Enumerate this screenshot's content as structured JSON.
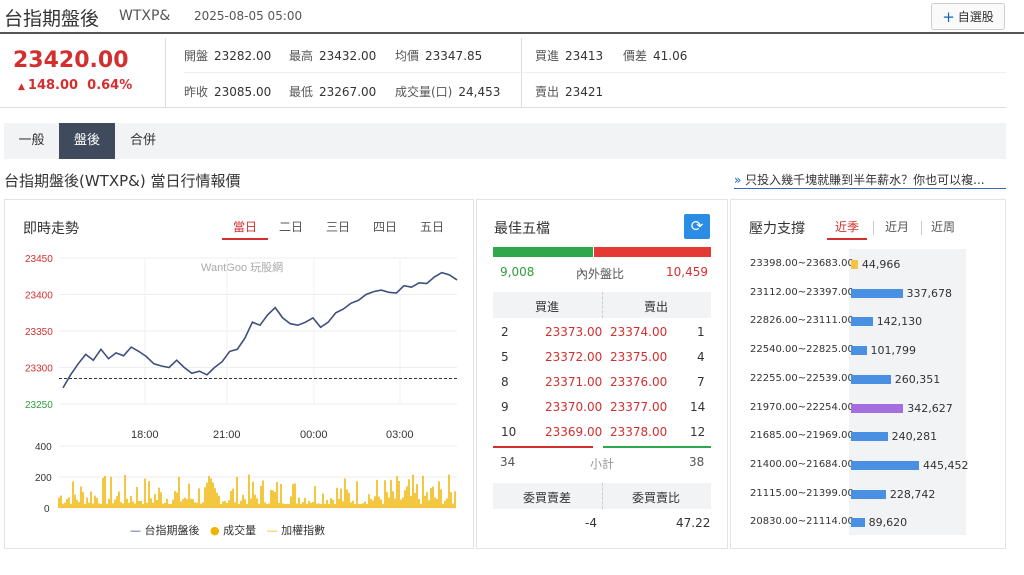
{
  "header": {
    "name": "台指期盤後",
    "code": "WTXP&",
    "time": "2025-08-05 05:00",
    "add_label": "自選股"
  },
  "quote": {
    "price": "23420.00",
    "change": "148.00",
    "pct": "0.64%",
    "open_label": "開盤",
    "open": "23282.00",
    "high_label": "最高",
    "high": "23432.00",
    "avg_label": "均價",
    "avg": "23347.85",
    "bid_label": "買進",
    "bid": "23413",
    "spread_label": "價差",
    "spread": "41.06",
    "prev_label": "昨收",
    "prev": "23085.00",
    "low_label": "最低",
    "low": "23267.00",
    "vol_label": "成交量(口)",
    "vol": "24,453",
    "ask_label": "賣出",
    "ask": "23421"
  },
  "tabs": [
    "一般",
    "盤後",
    "合併"
  ],
  "subtitle": "台指期盤後(WTXP&) 當日行情報價",
  "promo": "只投入幾千塊就賺到半年薪水？你也可以複...",
  "trend": {
    "title": "即時走勢",
    "ranges": [
      "當日",
      "二日",
      "三日",
      "四日",
      "五日"
    ],
    "watermark": "WantGoo 玩股網",
    "legend": [
      "台指期盤後",
      "成交量",
      "加權指數"
    ]
  },
  "chart_data": {
    "type": "line",
    "x_ticks": [
      "18:00",
      "21:00",
      "00:00",
      "03:00"
    ],
    "ylim": [
      23250,
      23450
    ],
    "y_ticks": [
      23450,
      23400,
      23350,
      23300,
      23250
    ],
    "reference": 23285,
    "series": [
      {
        "name": "台指期盤後",
        "values": [
          23272,
          23290,
          23305,
          23318,
          23310,
          23325,
          23312,
          23320,
          23316,
          23328,
          23322,
          23315,
          23305,
          23302,
          23300,
          23310,
          23300,
          23292,
          23295,
          23290,
          23300,
          23308,
          23322,
          23325,
          23340,
          23362,
          23358,
          23372,
          23382,
          23368,
          23360,
          23358,
          23362,
          23368,
          23355,
          23362,
          23375,
          23380,
          23388,
          23392,
          23400,
          23404,
          23406,
          23403,
          23402,
          23412,
          23410,
          23416,
          23415,
          23424,
          23430,
          23427,
          23420
        ]
      }
    ],
    "volume": {
      "ylim": [
        0,
        400
      ],
      "y_ticks": [
        400,
        200,
        0
      ]
    }
  },
  "best5": {
    "title": "最佳五檔",
    "inner": "9,008",
    "outer": "10,459",
    "ratio_label": "內外盤比",
    "buy_label": "買進",
    "sell_label": "賣出",
    "rows": [
      {
        "bv": "2",
        "bp": "23373.00",
        "sp": "23374.00",
        "sv": "1"
      },
      {
        "bv": "5",
        "bp": "23372.00",
        "sp": "23375.00",
        "sv": "4"
      },
      {
        "bv": "8",
        "bp": "23371.00",
        "sp": "23376.00",
        "sv": "7"
      },
      {
        "bv": "9",
        "bp": "23370.00",
        "sp": "23377.00",
        "sv": "14"
      },
      {
        "bv": "10",
        "bp": "23369.00",
        "sp": "23378.00",
        "sv": "12"
      }
    ],
    "sum_buy": "34",
    "sum_label": "小計",
    "sum_sell": "38",
    "diff_label": "委買賣差",
    "ratio2_label": "委買賣比",
    "diff": "-4",
    "ratio2": "47.22"
  },
  "pressure": {
    "title": "壓力支撐",
    "ranges": [
      "近季",
      "近月",
      "近周"
    ],
    "rows": [
      {
        "range": "23398.00~23683.00",
        "value": "44,966",
        "v": 44966,
        "color": "#f6c445"
      },
      {
        "range": "23112.00~23397.00",
        "value": "337,678",
        "v": 337678,
        "color": "#4a90e2"
      },
      {
        "range": "22826.00~23111.00",
        "value": "142,130",
        "v": 142130,
        "color": "#4a90e2"
      },
      {
        "range": "22540.00~22825.00",
        "value": "101,799",
        "v": 101799,
        "color": "#4a90e2"
      },
      {
        "range": "22255.00~22539.00",
        "value": "260,351",
        "v": 260351,
        "color": "#4a90e2"
      },
      {
        "range": "21970.00~22254.00",
        "value": "342,627",
        "v": 342627,
        "color": "#a56ee0"
      },
      {
        "range": "21685.00~21969.00",
        "value": "240,281",
        "v": 240281,
        "color": "#4a90e2"
      },
      {
        "range": "21400.00~21684.00",
        "value": "445,452",
        "v": 445452,
        "color": "#4a90e2"
      },
      {
        "range": "21115.00~21399.00",
        "value": "228,742",
        "v": 228742,
        "color": "#4a90e2"
      },
      {
        "range": "20830.00~21114.00",
        "value": "89,620",
        "v": 89620,
        "color": "#4a90e2"
      }
    ]
  }
}
